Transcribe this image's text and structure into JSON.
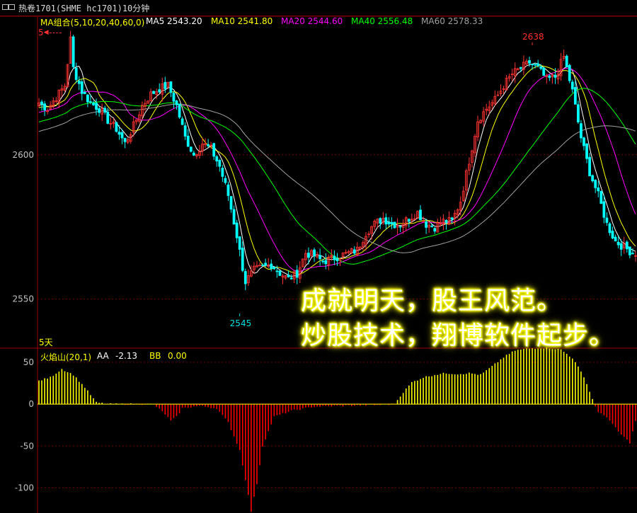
{
  "window": {
    "title": "热卷1701(SHME hc1701)10分钟",
    "icon": "window-icon"
  },
  "legend": {
    "group": "MA组合(5,10,20,40,60,0)",
    "items": [
      {
        "label": "MA5 2543.20",
        "color": "#ffffff"
      },
      {
        "label": "MA10 2541.80",
        "color": "#ffff00"
      },
      {
        "label": "MA20 2544.60",
        "color": "#ff00ff"
      },
      {
        "label": "MA40 2556.48",
        "color": "#00ff00"
      },
      {
        "label": "MA60 2578.33",
        "color": "#a0a0a0"
      }
    ],
    "group_color": "#ffff00"
  },
  "corner_labels": {
    "top_left": "5",
    "bottom_left": "5天"
  },
  "slogan": {
    "line1": "成就明天，股王风范。",
    "line2": "炒股技术，翔博软件起步。"
  },
  "indicator_legend": {
    "name": "火焰山(20,1)",
    "aa_label": "AA",
    "aa_value": "-2.13",
    "bb_label": "BB",
    "bb_value": "0.00"
  },
  "chart_data": [
    {
      "type": "candlestick",
      "panel": "price",
      "y_range": [
        2533,
        2648
      ],
      "y_ticks": [
        2550,
        2600
      ],
      "y_tick_labels": [
        "2550",
        "2600"
      ],
      "annotations": [
        {
          "text": "2638",
          "value": 2638,
          "bar": 172,
          "color": "#ff3030"
        },
        {
          "text": "2545",
          "value": 2545,
          "bar": 70,
          "color": "#00e0e0"
        }
      ],
      "anchors": [
        [
          0,
          2618
        ],
        [
          3,
          2616
        ],
        [
          6,
          2620
        ],
        [
          9,
          2624
        ],
        [
          10,
          2632
        ],
        [
          11,
          2640
        ],
        [
          12,
          2630
        ],
        [
          15,
          2622
        ],
        [
          18,
          2618
        ],
        [
          21,
          2616
        ],
        [
          24,
          2612
        ],
        [
          27,
          2609
        ],
        [
          30,
          2604
        ],
        [
          33,
          2610
        ],
        [
          36,
          2617
        ],
        [
          39,
          2621
        ],
        [
          42,
          2623
        ],
        [
          45,
          2624
        ],
        [
          48,
          2617
        ],
        [
          51,
          2606
        ],
        [
          54,
          2600
        ],
        [
          57,
          2604
        ],
        [
          60,
          2602
        ],
        [
          63,
          2596
        ],
        [
          66,
          2586
        ],
        [
          69,
          2572
        ],
        [
          71,
          2561
        ],
        [
          72,
          2556
        ],
        [
          75,
          2560
        ],
        [
          78,
          2561
        ],
        [
          81,
          2562
        ],
        [
          84,
          2559
        ],
        [
          87,
          2557
        ],
        [
          90,
          2559
        ],
        [
          93,
          2566
        ],
        [
          96,
          2565
        ],
        [
          99,
          2563
        ],
        [
          102,
          2564
        ],
        [
          105,
          2565
        ],
        [
          108,
          2566
        ],
        [
          111,
          2567
        ],
        [
          114,
          2573
        ],
        [
          117,
          2576
        ],
        [
          120,
          2578
        ],
        [
          123,
          2576
        ],
        [
          126,
          2576
        ],
        [
          129,
          2578
        ],
        [
          132,
          2580
        ],
        [
          135,
          2576
        ],
        [
          138,
          2575
        ],
        [
          141,
          2577
        ],
        [
          144,
          2577
        ],
        [
          147,
          2584
        ],
        [
          150,
          2598
        ],
        [
          153,
          2612
        ],
        [
          156,
          2616
        ],
        [
          159,
          2619
        ],
        [
          162,
          2624
        ],
        [
          165,
          2628
        ],
        [
          168,
          2630
        ],
        [
          171,
          2632
        ],
        [
          174,
          2630
        ],
        [
          177,
          2626
        ],
        [
          180,
          2627
        ],
        [
          183,
          2634
        ],
        [
          186,
          2622
        ],
        [
          189,
          2606
        ],
        [
          192,
          2594
        ],
        [
          195,
          2586
        ],
        [
          198,
          2576
        ],
        [
          201,
          2570
        ],
        [
          204,
          2568
        ],
        [
          207,
          2566
        ],
        [
          208,
          2566
        ]
      ],
      "candle_count": 209,
      "series": [
        {
          "name": "MA5",
          "period": 5,
          "color": "#ffffff"
        },
        {
          "name": "MA10",
          "period": 10,
          "color": "#ffff00"
        },
        {
          "name": "MA20",
          "period": 20,
          "color": "#ff00ff"
        },
        {
          "name": "MA40",
          "period": 40,
          "color": "#00ff00"
        },
        {
          "name": "MA60",
          "period": 60,
          "color": "#a0a0a0"
        }
      ],
      "up_color": "#ff3232",
      "down_color": "#00ffff"
    },
    {
      "type": "bar",
      "panel": "indicator",
      "name": "火焰山(20,1)",
      "y_range": [
        -130,
        66
      ],
      "y_ticks": [
        50,
        0,
        -50,
        -100
      ],
      "y_tick_labels": [
        "50",
        "0",
        "-50",
        "-100"
      ],
      "anchors": [
        [
          0,
          28
        ],
        [
          4,
          32
        ],
        [
          8,
          42
        ],
        [
          12,
          35
        ],
        [
          16,
          20
        ],
        [
          20,
          2
        ],
        [
          24,
          0
        ],
        [
          40,
          0
        ],
        [
          44,
          -12
        ],
        [
          46,
          -20
        ],
        [
          48,
          -15
        ],
        [
          50,
          -5
        ],
        [
          56,
          -2
        ],
        [
          62,
          -5
        ],
        [
          66,
          -22
        ],
        [
          70,
          -55
        ],
        [
          72,
          -90
        ],
        [
          74,
          -128
        ],
        [
          76,
          -95
        ],
        [
          78,
          -50
        ],
        [
          82,
          -15
        ],
        [
          88,
          -8
        ],
        [
          96,
          -3
        ],
        [
          106,
          -2
        ],
        [
          118,
          -1
        ],
        [
          124,
          0
        ],
        [
          126,
          10
        ],
        [
          130,
          26
        ],
        [
          134,
          32
        ],
        [
          138,
          35
        ],
        [
          142,
          37
        ],
        [
          146,
          36
        ],
        [
          150,
          37
        ],
        [
          154,
          35
        ],
        [
          158,
          45
        ],
        [
          162,
          56
        ],
        [
          166,
          64
        ],
        [
          170,
          66
        ],
        [
          174,
          67
        ],
        [
          178,
          67
        ],
        [
          182,
          65
        ],
        [
          186,
          55
        ],
        [
          190,
          33
        ],
        [
          193,
          6
        ],
        [
          195,
          -10
        ],
        [
          198,
          -15
        ],
        [
          202,
          -33
        ],
        [
          206,
          -46
        ],
        [
          208,
          -20
        ]
      ],
      "positive_color": "#ffff00",
      "negative_color": "#ff0000"
    }
  ]
}
